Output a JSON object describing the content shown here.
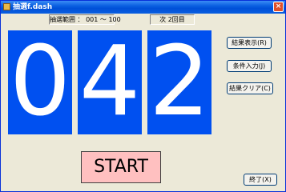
{
  "window": {
    "title": "抽選f.dash",
    "close_glyph": "×"
  },
  "status": {
    "range_text": "抽選範囲 ： 001 ～ 100",
    "next_text": "次 2回目"
  },
  "digits": [
    "0",
    "4",
    "2"
  ],
  "buttons": {
    "show_results": "結果表示(R)",
    "input_conditions": "条件入力(J)",
    "clear_results": "結果クリア(C)",
    "start": "START",
    "exit": "終了(X)"
  },
  "colors": {
    "digit_background": "#0050f0",
    "start_background": "#ffc0c0",
    "titlebar": "#0a5fe0"
  }
}
